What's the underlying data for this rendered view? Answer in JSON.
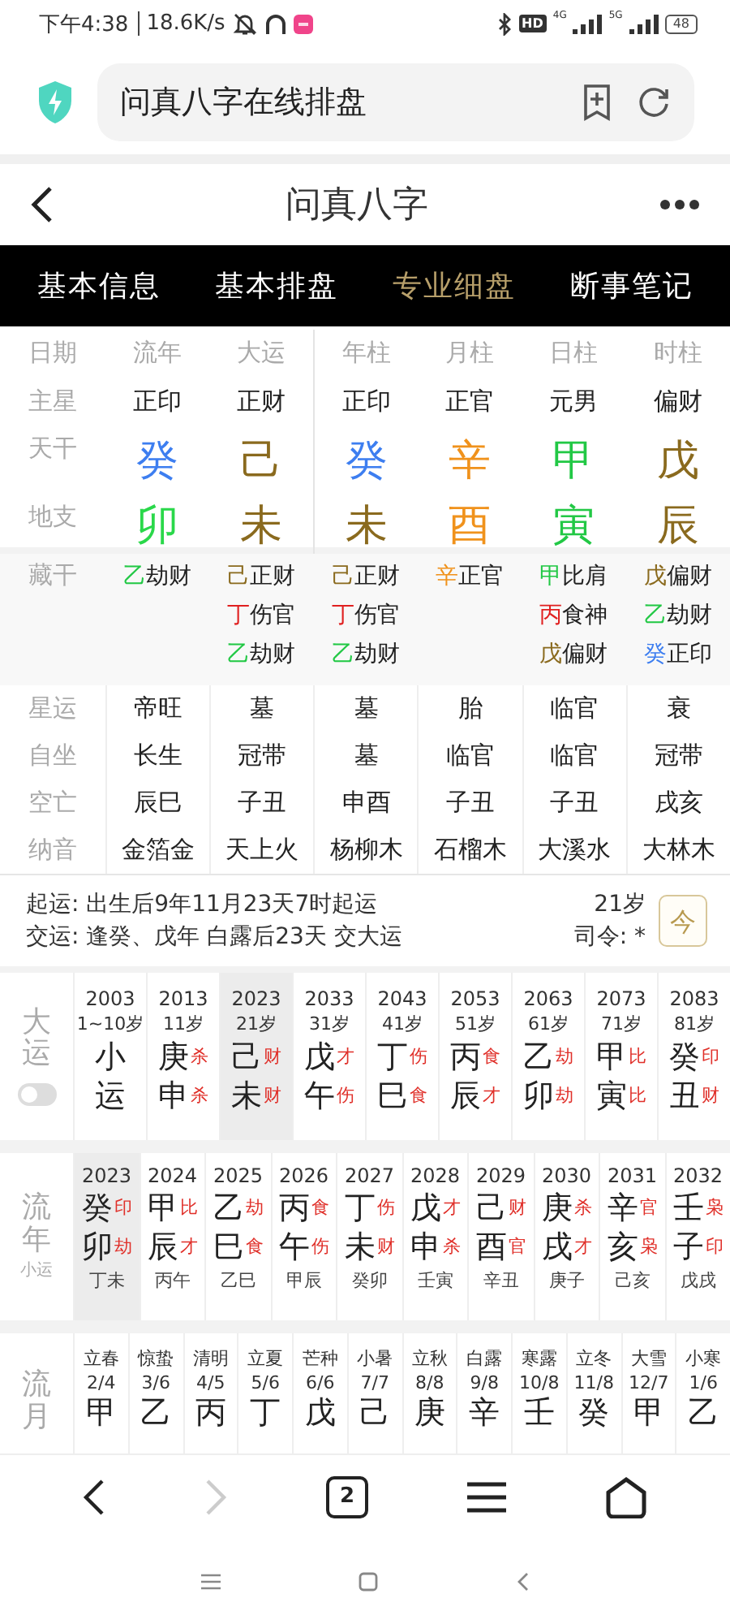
{
  "status_bar": {
    "time": "下午4:38",
    "speed": "18.6K/s",
    "hd": "HD",
    "network_1": "4G",
    "network_2": "5G",
    "battery": "48"
  },
  "browser": {
    "title": "问真八字在线排盘"
  },
  "header": {
    "title": "问真八字"
  },
  "tabs": [
    {
      "label": "基本信息",
      "selected": false
    },
    {
      "label": "基本排盘",
      "selected": false
    },
    {
      "label": "专业细盘",
      "selected": true
    },
    {
      "label": "断事笔记",
      "selected": false
    }
  ],
  "pillars": {
    "corner": "日期",
    "row_labels": [
      "主星",
      "天干",
      "地支"
    ],
    "columns": [
      {
        "name": "流年",
        "star": "正印",
        "stem": {
          "text": "癸",
          "color": "#3d7ef0"
        },
        "branch": {
          "text": "卯",
          "color": "#2ad84a"
        }
      },
      {
        "name": "大运",
        "star": "正财",
        "stem": {
          "text": "己",
          "color": "#8a6a1e"
        },
        "branch": {
          "text": "未",
          "color": "#8a6a1e"
        }
      },
      {
        "name": "年柱",
        "star": "正印",
        "stem": {
          "text": "癸",
          "color": "#3d7ef0"
        },
        "branch": {
          "text": "未",
          "color": "#8a6a1e"
        }
      },
      {
        "name": "月柱",
        "star": "正官",
        "stem": {
          "text": "辛",
          "color": "#f0921c"
        },
        "branch": {
          "text": "酉",
          "color": "#f0921c"
        }
      },
      {
        "name": "日柱",
        "star": "元男",
        "stem": {
          "text": "甲",
          "color": "#22c845"
        },
        "branch": {
          "text": "寅",
          "color": "#22c845"
        }
      },
      {
        "name": "时柱",
        "star": "偏财",
        "stem": {
          "text": "戊",
          "color": "#8a6a1e"
        },
        "branch": {
          "text": "辰",
          "color": "#8a6a1e"
        }
      }
    ]
  },
  "hidden_stems": {
    "label": "藏干",
    "columns": [
      [
        {
          "stem": "乙",
          "color": "#22c845",
          "god": "劫财"
        }
      ],
      [
        {
          "stem": "己",
          "color": "#8a6a1e",
          "god": "正财"
        },
        {
          "stem": "丁",
          "color": "#e02020",
          "god": "伤官"
        },
        {
          "stem": "乙",
          "color": "#22c845",
          "god": "劫财"
        }
      ],
      [
        {
          "stem": "己",
          "color": "#8a6a1e",
          "god": "正财"
        },
        {
          "stem": "丁",
          "color": "#e02020",
          "god": "伤官"
        },
        {
          "stem": "乙",
          "color": "#22c845",
          "god": "劫财"
        }
      ],
      [
        {
          "stem": "辛",
          "color": "#f0921c",
          "god": "正官"
        }
      ],
      [
        {
          "stem": "甲",
          "color": "#22c845",
          "god": "比肩"
        },
        {
          "stem": "丙",
          "color": "#e02020",
          "god": "食神"
        },
        {
          "stem": "戊",
          "color": "#8a6a1e",
          "god": "偏财"
        }
      ],
      [
        {
          "stem": "戊",
          "color": "#8a6a1e",
          "god": "偏财"
        },
        {
          "stem": "乙",
          "color": "#22c845",
          "god": "劫财"
        },
        {
          "stem": "癸",
          "color": "#3d7ef0",
          "god": "正印"
        }
      ]
    ]
  },
  "star_rows": [
    {
      "label": "星运",
      "values": [
        "帝旺",
        "墓",
        "墓",
        "胎",
        "临官",
        "衰"
      ]
    },
    {
      "label": "自坐",
      "values": [
        "长生",
        "冠带",
        "墓",
        "临官",
        "临官",
        "冠带"
      ]
    },
    {
      "label": "空亡",
      "values": [
        "辰巳",
        "子丑",
        "申酉",
        "子丑",
        "子丑",
        "戌亥"
      ]
    },
    {
      "label": "纳音",
      "values": [
        "金箔金",
        "天上火",
        "杨柳木",
        "石榴木",
        "大溪水",
        "大林木"
      ]
    }
  ],
  "qiyun": {
    "start": "起运: 出生后9年11月23天7时起运",
    "handover": "交运: 逢癸、戊年 白露后23天 交大运",
    "age": "21岁",
    "siling": "司令: *",
    "today": "今"
  },
  "dayun": {
    "label": "大运",
    "toggle_on": false,
    "items": [
      {
        "year": "2003",
        "age": "1~10岁",
        "stem": "小",
        "branch": "运",
        "selected": false
      },
      {
        "year": "2013",
        "age": "11岁",
        "stem": "庚",
        "stem_tag": "杀",
        "branch": "申",
        "branch_tag": "杀",
        "selected": false
      },
      {
        "year": "2023",
        "age": "21岁",
        "stem": "己",
        "stem_tag": "财",
        "branch": "未",
        "branch_tag": "财",
        "selected": true
      },
      {
        "year": "2033",
        "age": "31岁",
        "stem": "戊",
        "stem_tag": "才",
        "branch": "午",
        "branch_tag": "伤",
        "selected": false
      },
      {
        "year": "2043",
        "age": "41岁",
        "stem": "丁",
        "stem_tag": "伤",
        "branch": "巳",
        "branch_tag": "食",
        "selected": false
      },
      {
        "year": "2053",
        "age": "51岁",
        "stem": "丙",
        "stem_tag": "食",
        "branch": "辰",
        "branch_tag": "才",
        "selected": false
      },
      {
        "year": "2063",
        "age": "61岁",
        "stem": "乙",
        "stem_tag": "劫",
        "branch": "卯",
        "branch_tag": "劫",
        "selected": false
      },
      {
        "year": "2073",
        "age": "71岁",
        "stem": "甲",
        "stem_tag": "比",
        "branch": "寅",
        "branch_tag": "比",
        "selected": false
      },
      {
        "year": "2083",
        "age": "81岁",
        "stem": "癸",
        "stem_tag": "印",
        "branch": "丑",
        "branch_tag": "财",
        "selected": false
      }
    ]
  },
  "liunian": {
    "label": "流年",
    "sub_label": "小运",
    "items": [
      {
        "year": "2023",
        "stem": "癸",
        "stem_tag": "印",
        "branch": "卯",
        "branch_tag": "劫",
        "xiaoyun": "丁未",
        "selected": true
      },
      {
        "year": "2024",
        "stem": "甲",
        "stem_tag": "比",
        "branch": "辰",
        "branch_tag": "才",
        "xiaoyun": "丙午",
        "selected": false
      },
      {
        "year": "2025",
        "stem": "乙",
        "stem_tag": "劫",
        "branch": "巳",
        "branch_tag": "食",
        "xiaoyun": "乙巳",
        "selected": false
      },
      {
        "year": "2026",
        "stem": "丙",
        "stem_tag": "食",
        "branch": "午",
        "branch_tag": "伤",
        "xiaoyun": "甲辰",
        "selected": false
      },
      {
        "year": "2027",
        "stem": "丁",
        "stem_tag": "伤",
        "branch": "未",
        "branch_tag": "财",
        "xiaoyun": "癸卯",
        "selected": false
      },
      {
        "year": "2028",
        "stem": "戊",
        "stem_tag": "才",
        "branch": "申",
        "branch_tag": "杀",
        "xiaoyun": "壬寅",
        "selected": false
      },
      {
        "year": "2029",
        "stem": "己",
        "stem_tag": "财",
        "branch": "酉",
        "branch_tag": "官",
        "xiaoyun": "辛丑",
        "selected": false
      },
      {
        "year": "2030",
        "stem": "庚",
        "stem_tag": "杀",
        "branch": "戌",
        "branch_tag": "才",
        "xiaoyun": "庚子",
        "selected": false
      },
      {
        "year": "2031",
        "stem": "辛",
        "stem_tag": "官",
        "branch": "亥",
        "branch_tag": "枭",
        "xiaoyun": "己亥",
        "selected": false
      },
      {
        "year": "2032",
        "stem": "壬",
        "stem_tag": "枭",
        "branch": "子",
        "branch_tag": "印",
        "xiaoyun": "戊戌",
        "selected": false
      }
    ]
  },
  "liuyue": {
    "label": "流月",
    "items": [
      {
        "term": "立春",
        "date": "2/4",
        "stem": "甲"
      },
      {
        "term": "惊蛰",
        "date": "3/6",
        "stem": "乙"
      },
      {
        "term": "清明",
        "date": "4/5",
        "stem": "丙"
      },
      {
        "term": "立夏",
        "date": "5/6",
        "stem": "丁"
      },
      {
        "term": "芒种",
        "date": "6/6",
        "stem": "戊"
      },
      {
        "term": "小暑",
        "date": "7/7",
        "stem": "己"
      },
      {
        "term": "立秋",
        "date": "8/8",
        "stem": "庚"
      },
      {
        "term": "白露",
        "date": "9/8",
        "stem": "辛"
      },
      {
        "term": "寒露",
        "date": "10/8",
        "stem": "壬"
      },
      {
        "term": "立冬",
        "date": "11/8",
        "stem": "癸"
      },
      {
        "term": "大雪",
        "date": "12/7",
        "stem": "甲"
      },
      {
        "term": "小寒",
        "date": "1/6",
        "stem": "乙"
      }
    ]
  },
  "toolbar": {
    "tab_count": "2",
    "forward_disabled": true
  }
}
